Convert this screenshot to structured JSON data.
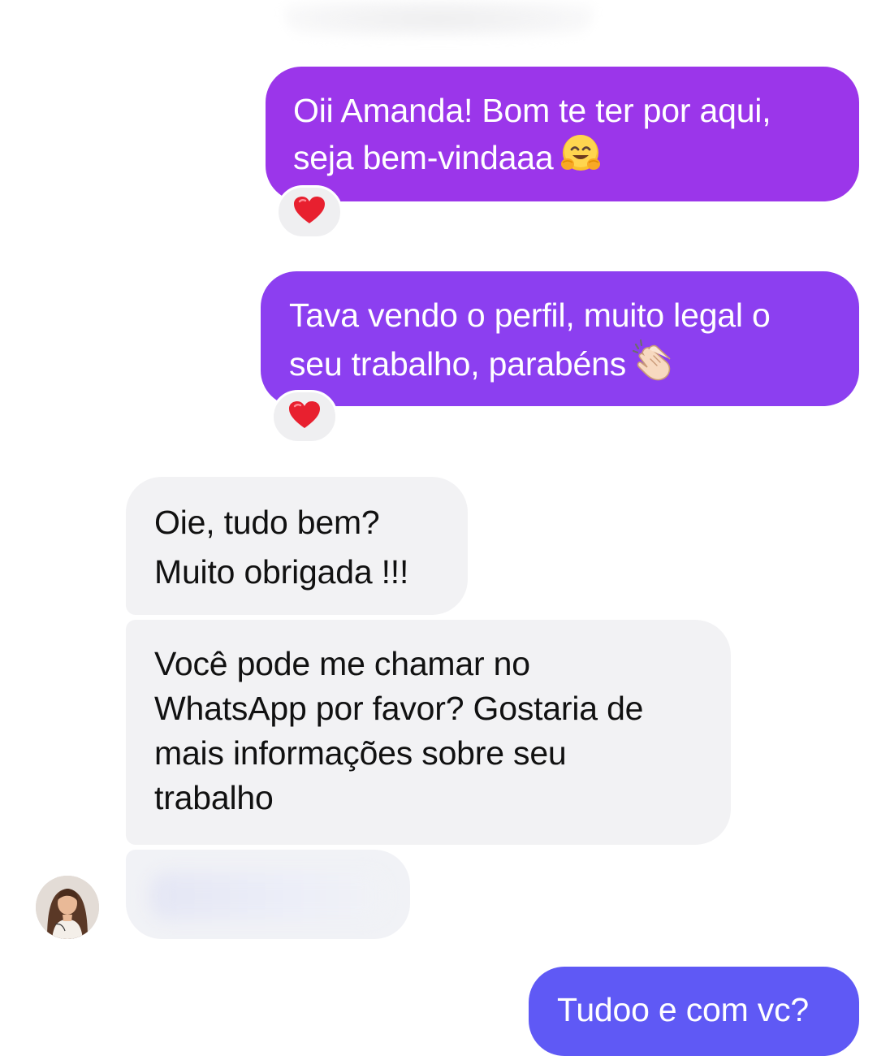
{
  "thread": {
    "messages": [
      {
        "sender": "me",
        "lines": [
          "Oii Amanda! Bom te ter por aqui,",
          "seja bem-vindaaa"
        ],
        "emoji": "hugging-face-emoji",
        "reaction": "heart-emoji"
      },
      {
        "sender": "me",
        "lines": [
          "Tava vendo o perfil, muito legal o",
          "seu trabalho, parabéns"
        ],
        "emoji": "clapping-hands-emoji",
        "reaction": "heart-emoji"
      },
      {
        "sender": "contact",
        "lines": [
          "Oie, tudo bem?",
          "Muito obrigada !!!"
        ]
      },
      {
        "sender": "contact",
        "lines": [
          "Você pode me chamar no",
          "WhatsApp por favor? Gostaria de",
          "mais informações sobre seu",
          "trabalho"
        ]
      },
      {
        "sender": "contact",
        "lines": [],
        "blurred": true
      },
      {
        "sender": "me",
        "lines": [
          "Tudoo e com vc?"
        ]
      }
    ]
  },
  "colors": {
    "sent_bubble_1": "#9b36ea",
    "sent_bubble_2": "#8c3ff0",
    "sent_bubble_3": "#5f59f5",
    "received_bubble": "#f2f2f4",
    "reaction_badge": "#efeff1",
    "heart": "#e8202f"
  }
}
